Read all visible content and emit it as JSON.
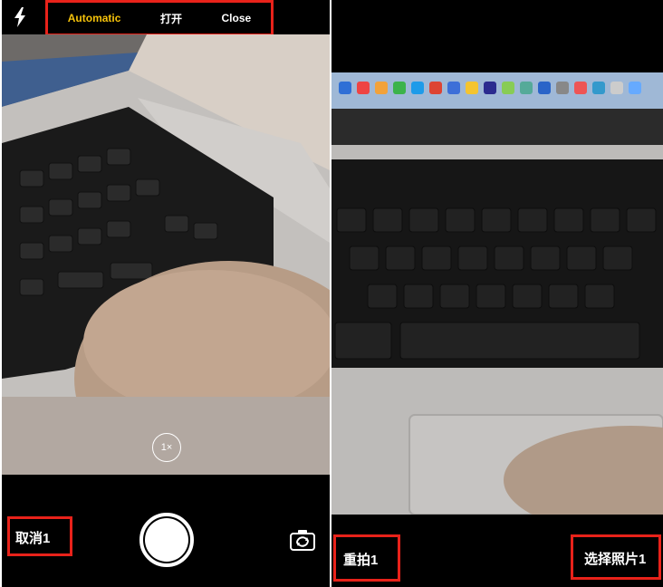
{
  "camera": {
    "flash_options": [
      "Automatic",
      "打开",
      "Close"
    ],
    "zoom_label": "1×",
    "cancel_label": "取消1"
  },
  "preview": {
    "retake_label": "重拍1",
    "use_photo_label": "选择照片1"
  },
  "colors": {
    "highlight_box": "#e8221a",
    "active_flash": "#f5c20a"
  },
  "icons": [
    "flash-icon",
    "switch-camera-icon",
    "shutter-button"
  ]
}
